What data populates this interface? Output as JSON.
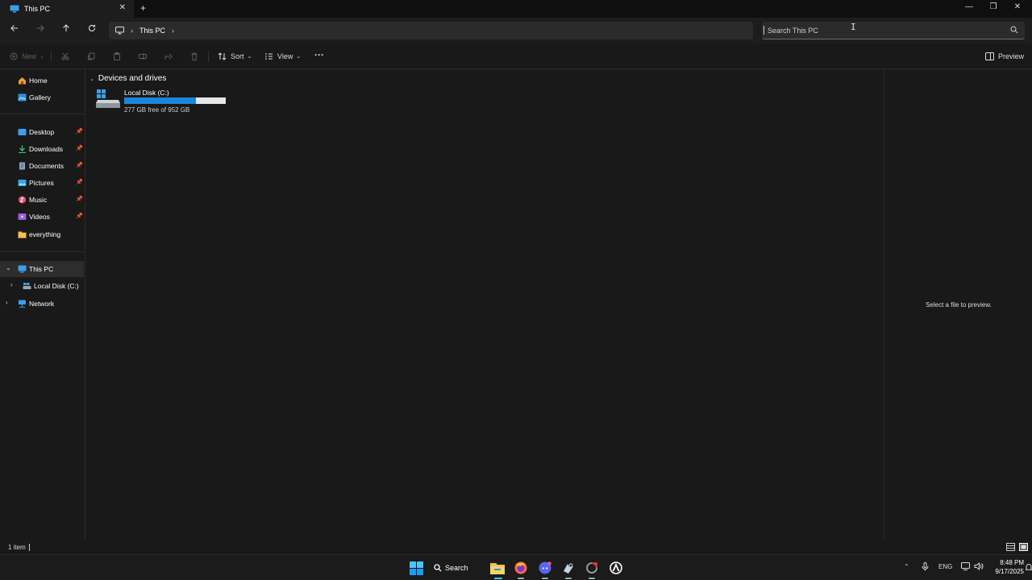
{
  "window": {
    "tab_title": "This PC",
    "tab_close": "✕",
    "new_tab": "+",
    "minimize": "—",
    "maximize": "❐",
    "close": "✕"
  },
  "address": {
    "crumb": "This PC",
    "search_placeholder": "Search This PC"
  },
  "commands": {
    "new_label": "New",
    "sort_label": "Sort",
    "view_label": "View",
    "more": "···",
    "preview_label": "Preview"
  },
  "sidebar": {
    "quick": [
      {
        "label": "Home"
      },
      {
        "label": "Gallery"
      }
    ],
    "pinned": [
      {
        "label": "Desktop",
        "icon": "desktop-icon"
      },
      {
        "label": "Downloads",
        "icon": "download-icon"
      },
      {
        "label": "Documents",
        "icon": "documents-icon"
      },
      {
        "label": "Pictures",
        "icon": "pictures-icon"
      },
      {
        "label": "Music",
        "icon": "music-icon"
      },
      {
        "label": "Videos",
        "icon": "videos-icon"
      },
      {
        "label": "everything",
        "icon": "folder-icon"
      }
    ],
    "tree": [
      {
        "label": "This PC"
      },
      {
        "label": "Local Disk (C:)"
      },
      {
        "label": "Network"
      }
    ]
  },
  "content": {
    "group_title": "Devices and drives",
    "drives": [
      {
        "name": "Local Disk (C:)",
        "free_text": "277 GB free of 952 GB",
        "used_fraction": 0.709
      }
    ]
  },
  "preview": {
    "message": "Select a file to preview."
  },
  "status": {
    "count": "1 item"
  },
  "taskbar": {
    "search_label": "Search",
    "language": "ENG",
    "time": "8:48 PM",
    "date": "9/17/2025"
  },
  "colors": {
    "accent": "#1a86d9",
    "background": "#191919",
    "selection": "#2d2d2d"
  }
}
